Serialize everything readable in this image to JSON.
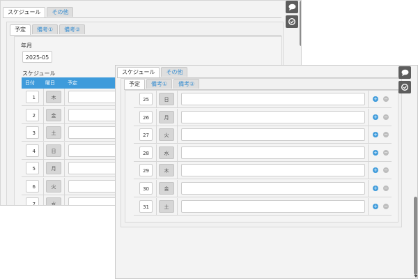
{
  "tabs_top": [
    {
      "label": "スケジュール"
    },
    {
      "label": "その他"
    }
  ],
  "subtabs": [
    {
      "label": "予定"
    },
    {
      "label": "備考①"
    },
    {
      "label": "備考②"
    }
  ],
  "month_label": "年月",
  "month_value": "2025-05",
  "schedule_label": "スケジュール",
  "table_header": {
    "day": "日付",
    "weekday": "曜日",
    "plan": "予定"
  },
  "back_rows": [
    {
      "day": "1",
      "wd": "木"
    },
    {
      "day": "2",
      "wd": "金"
    },
    {
      "day": "3",
      "wd": "土"
    },
    {
      "day": "4",
      "wd": "日"
    },
    {
      "day": "5",
      "wd": "月"
    },
    {
      "day": "6",
      "wd": "火"
    },
    {
      "day": "7",
      "wd": "水"
    }
  ],
  "front_rows": [
    {
      "day": "25",
      "wd": "日"
    },
    {
      "day": "26",
      "wd": "月"
    },
    {
      "day": "27",
      "wd": "火"
    },
    {
      "day": "28",
      "wd": "水"
    },
    {
      "day": "29",
      "wd": "木"
    },
    {
      "day": "30",
      "wd": "金"
    },
    {
      "day": "31",
      "wd": "土"
    }
  ],
  "icons": {
    "chat": "chat-bubble-icon",
    "check": "check-clock-icon"
  },
  "colors": {
    "header_blue": "#3e9bdb",
    "tab_link": "#3b8fd0",
    "icon_bg": "#5d5d5d"
  }
}
